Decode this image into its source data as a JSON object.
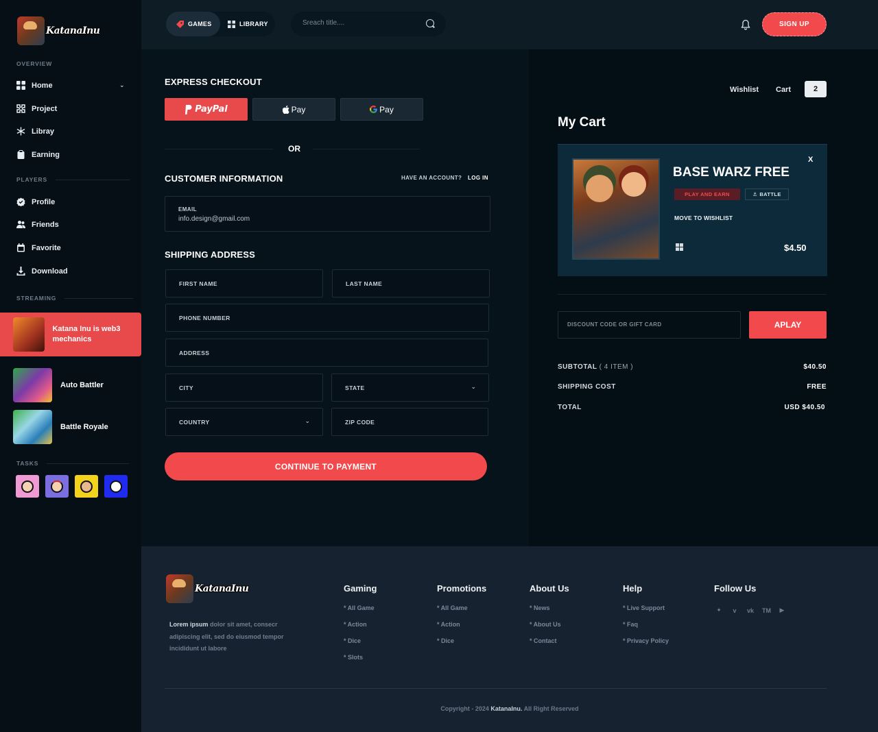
{
  "brand": {
    "name": "KatanaInu"
  },
  "sidebar": {
    "overview_title": "OVERVIEW",
    "overview_items": [
      {
        "label": "Home",
        "icon": "grid-icon"
      },
      {
        "label": "Project",
        "icon": "puzzle-icon"
      },
      {
        "label": "Libray",
        "icon": "snowflake-icon"
      },
      {
        "label": "Earning",
        "icon": "clipboard-icon"
      }
    ],
    "players_title": "PLAYERS",
    "players_items": [
      {
        "label": "Profile",
        "icon": "badge-check-icon"
      },
      {
        "label": "Friends",
        "icon": "users-icon"
      },
      {
        "label": "Favorite",
        "icon": "calendar-icon"
      },
      {
        "label": "Download",
        "icon": "download-icon"
      }
    ],
    "streaming_title": "STREAMING",
    "streams": [
      {
        "label": "Katana Inu is web3 mechanics",
        "active": true
      },
      {
        "label": "Auto Battler",
        "active": false
      },
      {
        "label": "Battle Royale",
        "active": false
      }
    ],
    "tasks_title": "TASKS"
  },
  "header": {
    "tab_games": "GAMES",
    "tab_library": "LIBRARY",
    "search_placeholder": "Sreach title....",
    "signup": "SIGN UP"
  },
  "checkout": {
    "express_title": "EXPRESS CHECKOUT",
    "paypal": "PayPal",
    "apple_pay": "Pay",
    "google_pay": "Pay",
    "or": "OR",
    "customer_title": "CUSTOMER INFORMATION",
    "have_account": "HAVE AN ACCOUNT?",
    "log_in": "LOG IN",
    "email_label": "EMAIL",
    "email_value": "info.design@gmail.com",
    "shipping_title": "SHIPPING ADDRESS",
    "first_name": "FIRST NAME",
    "last_name": "LAST NAME",
    "phone": "PHONE NUMBER",
    "address": "ADDRESS",
    "city": "CITY",
    "state": "STATE",
    "country": "COUNTRY",
    "zip": "ZIP CODE",
    "continue": "CONTINUE TO PAYMENT"
  },
  "cart": {
    "wishlist_link": "Wishlist",
    "cart_link": "Cart",
    "cart_count": "2",
    "title": "My Cart",
    "item": {
      "title": "BASE WARZ FREE",
      "badge_earn": "PLAY AND EARN",
      "badge_battle": "BATTLE",
      "move_wishlist": "MOVE TO WISHLIST",
      "price": "$4.50",
      "close": "X"
    },
    "discount_placeholder": "DISCOUNT CODE OR GIFT CARD",
    "apply": "APLAY",
    "subtotal_label": "SUBTOTAL",
    "subtotal_count": "( 4 ITEM )",
    "subtotal_value": "$40.50",
    "shipping_label": "SHIPPING COST",
    "shipping_value": "FREE",
    "total_label": "TOTAL",
    "total_value": "USD $40.50"
  },
  "footer": {
    "desc_bold": "Lorem ipsum",
    "desc_rest": "dolor sit amet, consecr adipiscing elit, sed do eiusmod tempor incididunt ut labore",
    "columns": [
      {
        "title": "Gaming",
        "items": [
          "* All Game",
          "* Action",
          "* Dice",
          "* Slots"
        ]
      },
      {
        "title": "Promotions",
        "items": [
          "* All Game",
          "* Action",
          "* Dice"
        ]
      },
      {
        "title": "About Us",
        "items": [
          "* News",
          "* About Us",
          "* Contact"
        ]
      },
      {
        "title": "Help",
        "items": [
          "* Live Support",
          "* Faq",
          "* Privacy Policy"
        ]
      }
    ],
    "follow_title": "Follow Us",
    "social_icons": [
      "twitter-icon",
      "vimeo-icon",
      "vk-icon",
      "tumblr-icon",
      "youtube-icon"
    ],
    "social_tm": "TM",
    "copyright_pre": "Copyright - 2024",
    "copyright_brand": "KatanaInu.",
    "copyright_post": "All Right Reserved"
  }
}
